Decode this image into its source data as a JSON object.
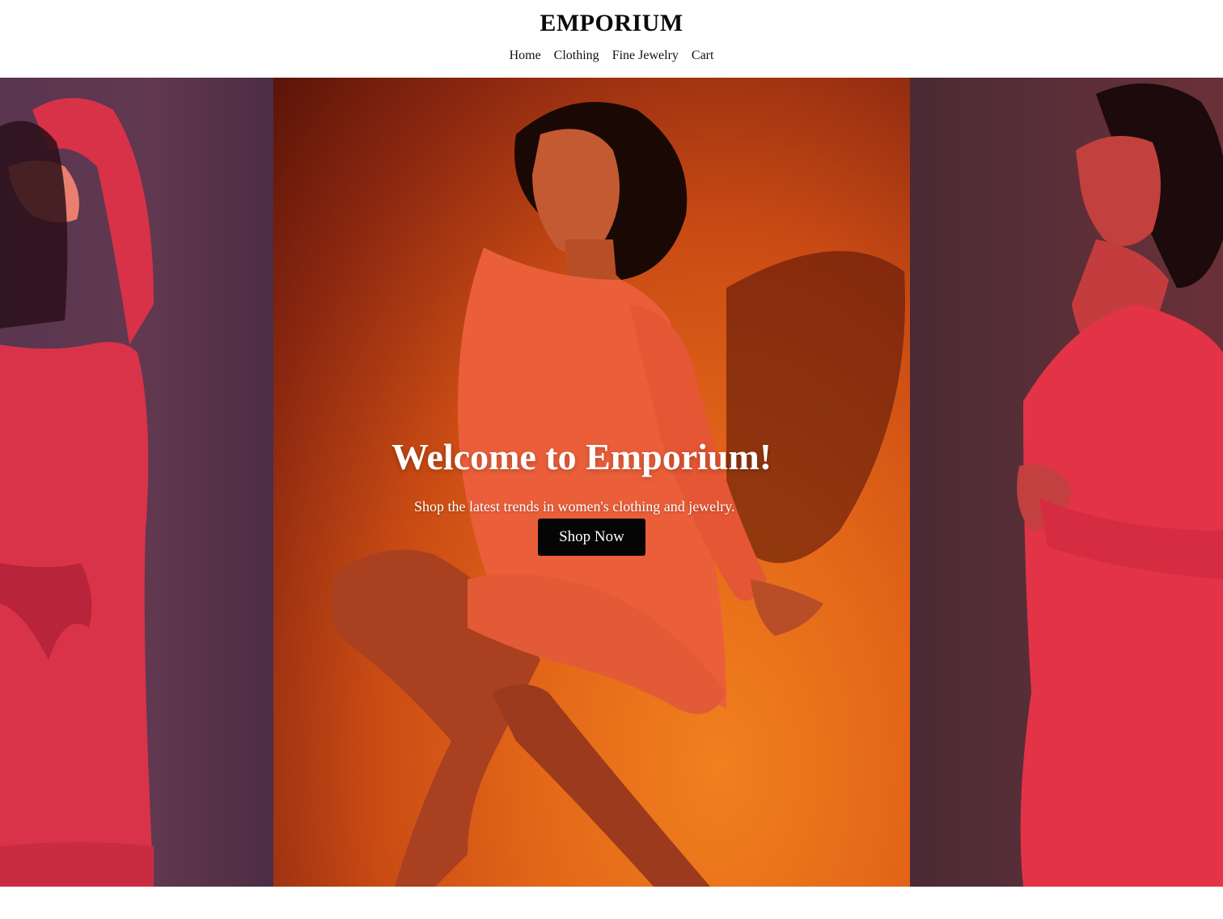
{
  "header": {
    "brand": "EMPORIUM",
    "nav": [
      {
        "label": "Home"
      },
      {
        "label": "Clothing"
      },
      {
        "label": "Fine Jewelry"
      },
      {
        "label": "Cart"
      }
    ]
  },
  "hero": {
    "title": "Welcome to Emporium!",
    "subtitle": "Shop the latest trends in women's clothing and jewelry.",
    "cta_label": "Shop Now"
  },
  "colors": {
    "header_bg": "#ffffff",
    "button_bg": "#050505",
    "hero_text": "#ffffff"
  }
}
